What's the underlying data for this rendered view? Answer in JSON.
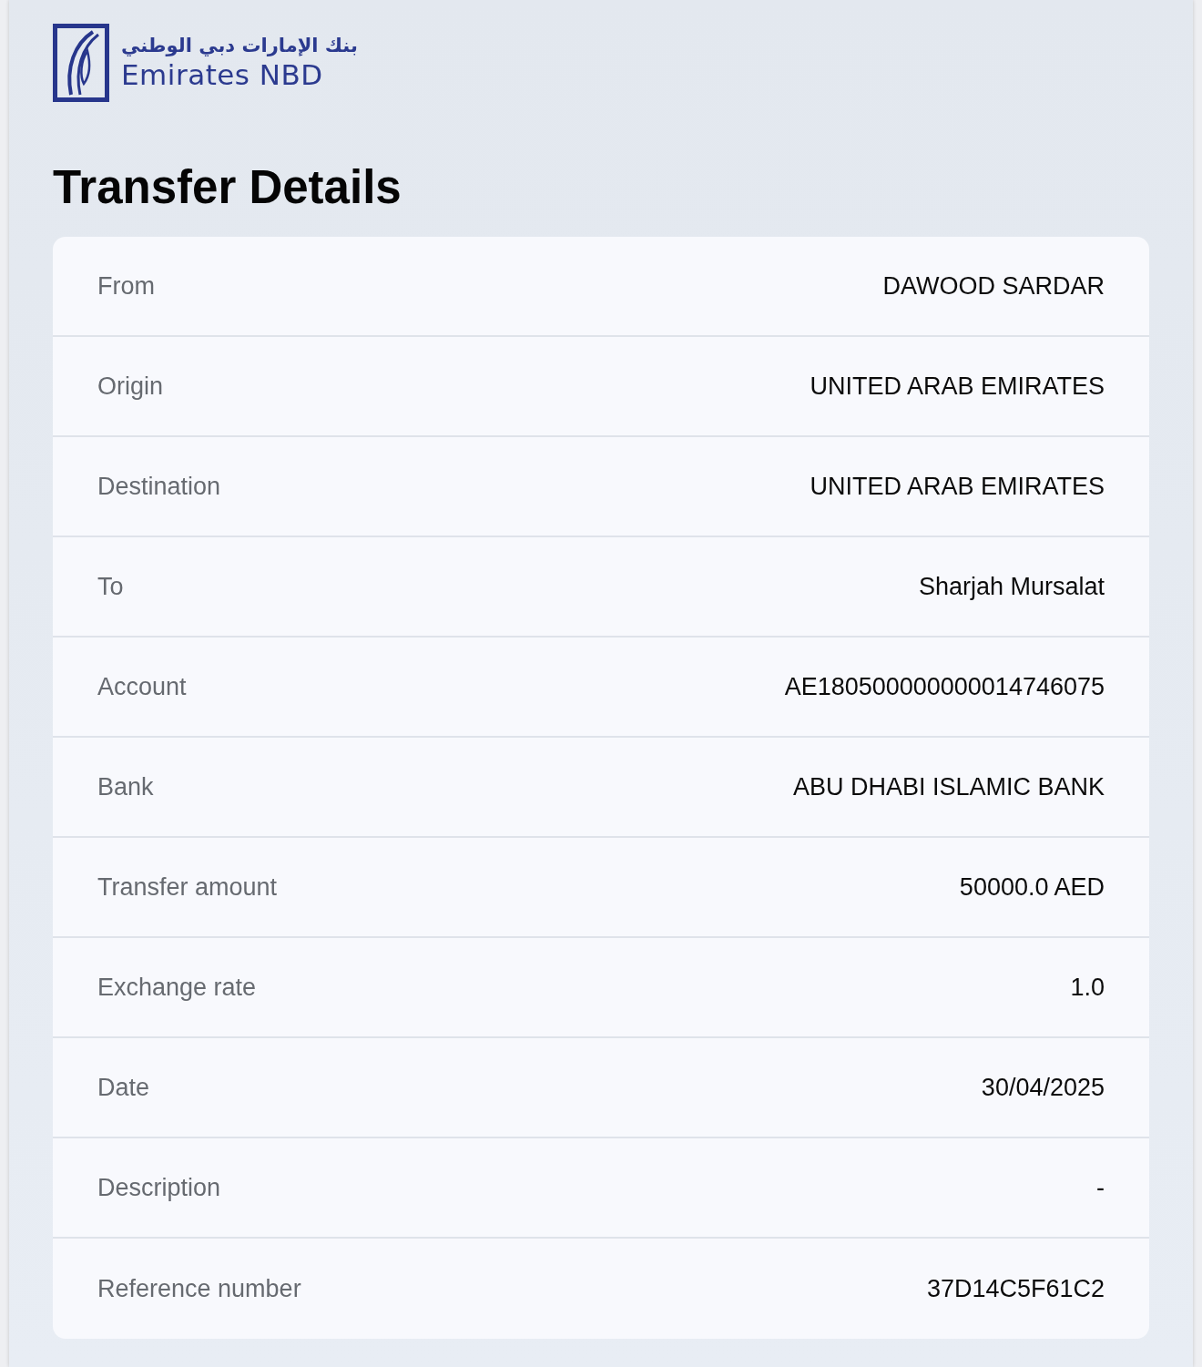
{
  "header": {
    "logo_arabic": "بنك الإمارات دبي الوطني",
    "logo_name": "Emirates NBD"
  },
  "title": "Transfer Details",
  "details": [
    {
      "label": "From",
      "value": "DAWOOD SARDAR"
    },
    {
      "label": "Origin",
      "value": "UNITED ARAB EMIRATES"
    },
    {
      "label": "Destination",
      "value": "UNITED ARAB EMIRATES"
    },
    {
      "label": "To",
      "value": "Sharjah Mursalat"
    },
    {
      "label": "Account",
      "value": "AE180500000000014746075"
    },
    {
      "label": "Bank",
      "value": "ABU DHABI ISLAMIC BANK"
    },
    {
      "label": "Transfer amount",
      "value": "50000.0 AED"
    },
    {
      "label": "Exchange rate",
      "value": "1.0"
    },
    {
      "label": "Date",
      "value": "30/04/2025"
    },
    {
      "label": "Description",
      "value": "-"
    },
    {
      "label": "Reference number",
      "value": "37D14C5F61C2"
    }
  ]
}
